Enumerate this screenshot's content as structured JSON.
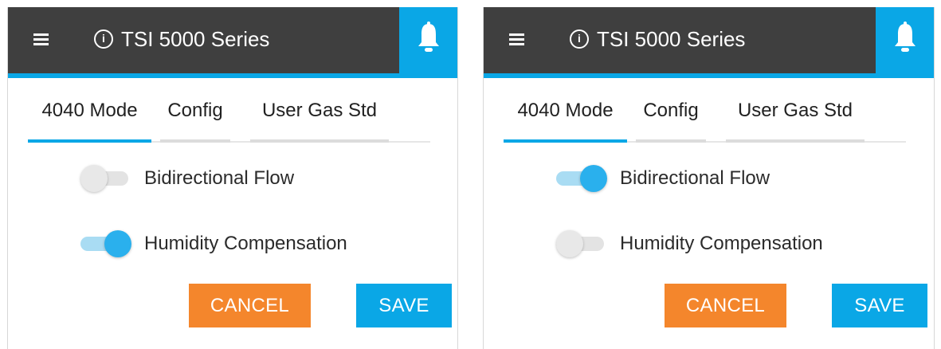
{
  "colors": {
    "appbar": "#3f3f3f",
    "accent": "#0aa7e6",
    "cancel": "#f4862c",
    "switch_on": "#2ab0ed"
  },
  "icons": {
    "menu": "hamburger-menu-icon",
    "info": "info-circle-icon",
    "bell": "bell-icon"
  },
  "panels": [
    {
      "header": {
        "title": "TSI 5000 Series",
        "info_glyph": "i"
      },
      "tabs": [
        {
          "label": "4040 Mode",
          "active": true
        },
        {
          "label": "Config",
          "active": false
        },
        {
          "label": "User Gas Std",
          "active": false
        }
      ],
      "toggles": [
        {
          "label": "Bidirectional Flow",
          "on": false
        },
        {
          "label": "Humidity Compensation",
          "on": true
        }
      ],
      "actions": {
        "cancel_label": "CANCEL",
        "save_label": "SAVE"
      }
    },
    {
      "header": {
        "title": "TSI 5000 Series",
        "info_glyph": "i"
      },
      "tabs": [
        {
          "label": "4040 Mode",
          "active": true
        },
        {
          "label": "Config",
          "active": false
        },
        {
          "label": "User Gas Std",
          "active": false
        }
      ],
      "toggles": [
        {
          "label": "Bidirectional Flow",
          "on": true
        },
        {
          "label": "Humidity Compensation",
          "on": false
        }
      ],
      "actions": {
        "cancel_label": "CANCEL",
        "save_label": "SAVE"
      }
    }
  ]
}
